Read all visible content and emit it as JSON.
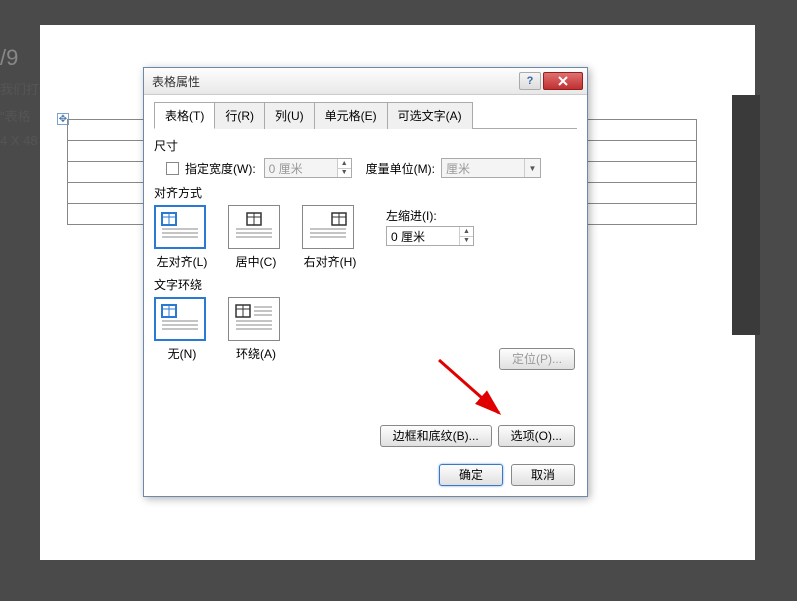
{
  "sidebar": {
    "line1": "/9",
    "line2": "我们打",
    "line3": "\"表格",
    "line4": "4 X 48"
  },
  "dialog": {
    "title": "表格属性",
    "tabs": [
      "表格(T)",
      "行(R)",
      "列(U)",
      "单元格(E)",
      "可选文字(A)"
    ],
    "size": {
      "label": "尺寸",
      "specify_width_label": "指定宽度(W):",
      "width_value": "0 厘米",
      "unit_label": "度量单位(M):",
      "unit_value": "厘米"
    },
    "align": {
      "label": "对齐方式",
      "items": [
        "左对齐(L)",
        "居中(C)",
        "右对齐(H)"
      ],
      "indent_label": "左缩进(I):",
      "indent_value": "0 厘米"
    },
    "wrap": {
      "label": "文字环绕",
      "items": [
        "无(N)",
        "环绕(A)"
      ]
    },
    "buttons": {
      "position": "定位(P)...",
      "border": "边框和底纹(B)...",
      "options": "选项(O)...",
      "ok": "确定",
      "cancel": "取消"
    }
  }
}
